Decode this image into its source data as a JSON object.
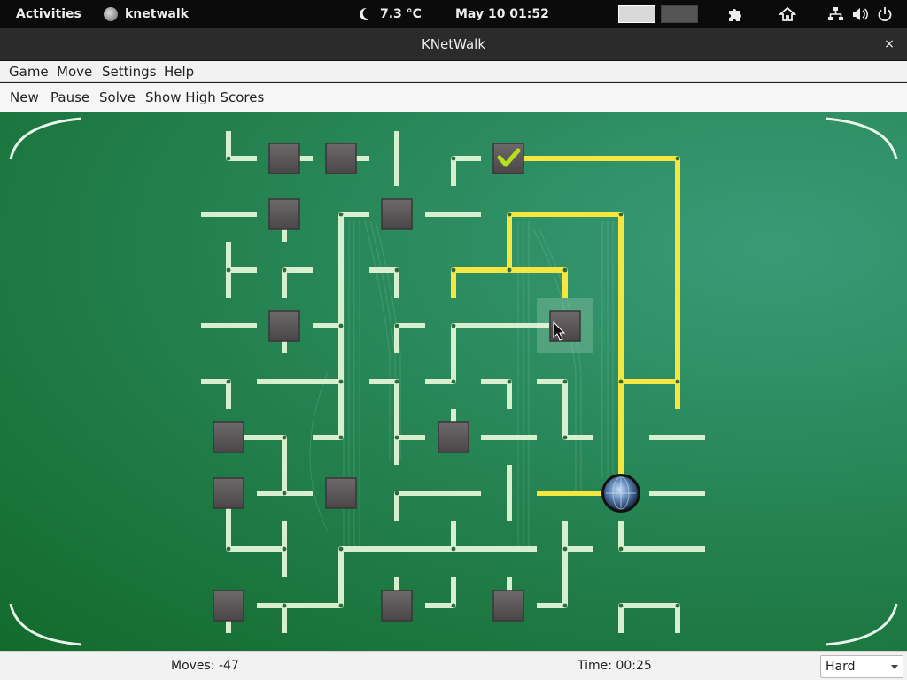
{
  "topbar": {
    "activities": "Activities",
    "app_name": "knetwalk",
    "weather": "7.3 °C",
    "clock": "May 10  01:52"
  },
  "window": {
    "title": "KNetWalk",
    "close_glyph": "×"
  },
  "menu": {
    "game": "Game",
    "move": "Move",
    "settings": "Settings",
    "help": "Help"
  },
  "toolbar": {
    "new": "New",
    "pause": "Pause",
    "solve": "Solve",
    "high_scores": "Show High Scores"
  },
  "status": {
    "moves": "Moves: -47",
    "time": "Time: 00:25",
    "difficulty": "Hard"
  },
  "colors": {
    "cable_unpowered": "#d8efcf",
    "cable_powered": "#f6e640",
    "terminal": "#5a5658",
    "board_green": "#1f7a45"
  },
  "icons": [
    "moon-icon",
    "extensions-icon",
    "home-icon",
    "network-icon",
    "volume-icon",
    "power-icon",
    "server-globe-icon",
    "checkmark-icon",
    "cursor-icon"
  ]
}
